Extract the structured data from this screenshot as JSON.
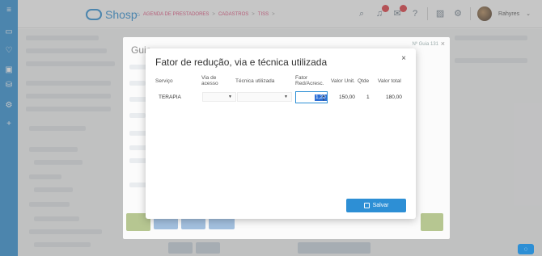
{
  "header": {
    "brand": "Shosp",
    "breadcrumb": [
      "AGENDA DE PRESTADORES",
      "CADASTROS",
      "TISS"
    ],
    "breadcrumb_sep": ">",
    "user_name": "Rahyres",
    "user_caret": "⌄"
  },
  "background_modal": {
    "title": "Guia",
    "number_label": "Nº Guia 131"
  },
  "dialog": {
    "title": "Fator de redução, via e técnica utilizada",
    "close_label": "×",
    "columns": [
      "Serviço",
      "Via de acesso",
      "Técnica utilizada",
      "Fator Red/Acresc.",
      "Valor Unit.",
      "Qtde",
      "Valor total"
    ],
    "rows": [
      {
        "servico": "TERAPIA",
        "via_de_acesso": "",
        "tecnica_utilizada": "",
        "fator": "1,20",
        "valor_unit": "150,00",
        "qtde": "1",
        "valor_total": "180,00"
      }
    ],
    "save_label": "Salvar"
  },
  "colors": {
    "primary": "#2d8fd5",
    "accent": "#e24c7a",
    "badge": "#e0373f"
  },
  "icons": {
    "rail": [
      "menu-icon",
      "calendar-icon",
      "heart-icon",
      "wallet-icon",
      "database-icon",
      "gear-icon",
      "add-icon"
    ],
    "header": [
      "search-icon",
      "bell-icon",
      "chat-icon",
      "help-icon",
      "image-icon",
      "settings-icon"
    ]
  }
}
